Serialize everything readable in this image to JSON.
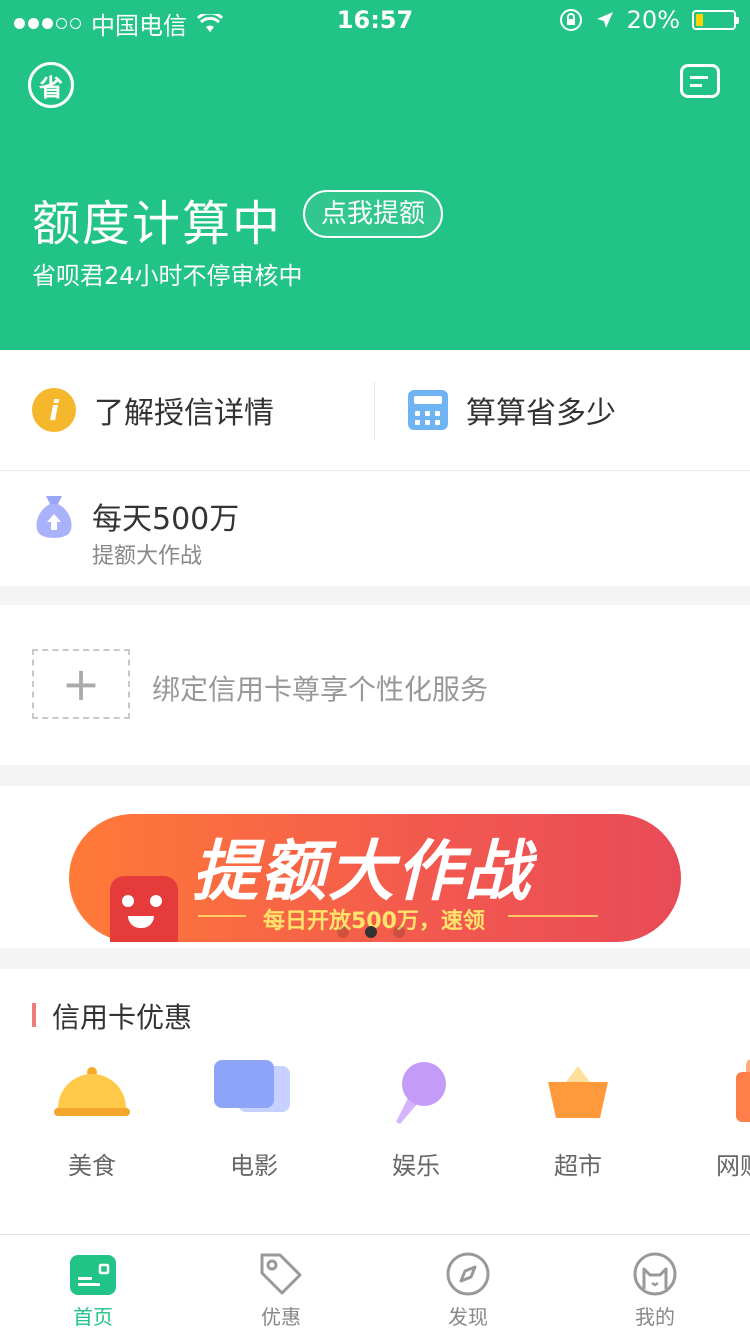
{
  "status_bar": {
    "carrier": "中国电信",
    "time": "16:57",
    "battery": "20%",
    "battery_level": 0.2,
    "signal_bars_filled": 3,
    "signal_bars_total": 5
  },
  "header": {
    "logo_char": "省",
    "title": "额度计算中",
    "raise_button": "点我提额",
    "subtitle": "省呗君24小时不停审核中",
    "background": "#22c387"
  },
  "quick_links": [
    {
      "label": "了解授信详情",
      "icon": "info-icon"
    },
    {
      "label": "算算省多少",
      "icon": "calculator-icon"
    }
  ],
  "promo": {
    "title": "每天500万",
    "subtitle": "提额大作战",
    "icon": "money-bag-icon"
  },
  "bind_card": {
    "plus": "+",
    "text": "绑定信用卡尊享个性化服务"
  },
  "banner": {
    "title": "提额大作战",
    "subtitle": "每日开放500万，速领",
    "active_page": 1,
    "page_count": 3
  },
  "deals": {
    "title": "信用卡优惠",
    "categories": [
      {
        "label": "美食",
        "icon": "food-cloche-icon"
      },
      {
        "label": "电影",
        "icon": "movie-camera-icon"
      },
      {
        "label": "娱乐",
        "icon": "microphone-icon"
      },
      {
        "label": "超市",
        "icon": "shopping-basket-icon"
      },
      {
        "label": "网购",
        "icon": "shopping-bag-icon"
      }
    ]
  },
  "tabbar": {
    "tabs": [
      {
        "label": "首页",
        "icon": "home-card-icon",
        "active": true
      },
      {
        "label": "优惠",
        "icon": "tag-icon",
        "active": false
      },
      {
        "label": "发现",
        "icon": "compass-icon",
        "active": false
      },
      {
        "label": "我的",
        "icon": "profile-cat-icon",
        "active": false
      }
    ],
    "active_color": "#22c387"
  }
}
